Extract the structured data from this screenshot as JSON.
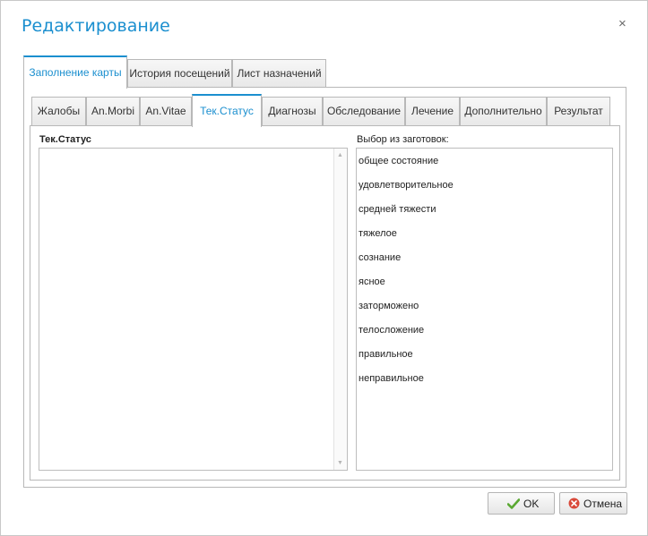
{
  "dialog": {
    "title": "Редактирование",
    "close_symbol": "×"
  },
  "outer_tabs": [
    {
      "label": "Заполнение карты",
      "active": true
    },
    {
      "label": "История посещений",
      "active": false
    },
    {
      "label": "Лист назначений",
      "active": false
    }
  ],
  "inner_tabs": [
    {
      "label": "Жалобы",
      "active": false
    },
    {
      "label": "An.Morbi",
      "active": false
    },
    {
      "label": "An.Vitae",
      "active": false
    },
    {
      "label": "Тек.Статус",
      "active": true
    },
    {
      "label": "Диагнозы",
      "active": false
    },
    {
      "label": "Обследование",
      "active": false
    },
    {
      "label": "Лечение",
      "active": false
    },
    {
      "label": "Дополнительно",
      "active": false
    },
    {
      "label": "Результат",
      "active": false
    }
  ],
  "content": {
    "left_label": "Тек.Статус",
    "right_label": "Выбор из заготовок:",
    "text_value": "",
    "templates": [
      "общее состояние",
      "удовлетворительное",
      "средней тяжести",
      "тяжелое",
      "сознание",
      "ясное",
      "заторможено",
      "телосложение",
      "правильное",
      "неправильное"
    ]
  },
  "buttons": {
    "ok_label": "OK",
    "cancel_label": "Отмена"
  },
  "colors": {
    "accent": "#1b8fcf",
    "ok_icon": "#5aa832",
    "cancel_icon": "#d9493a"
  },
  "icons": {
    "ok": "checkmark-icon",
    "cancel": "cancel-icon",
    "close": "close-icon"
  }
}
